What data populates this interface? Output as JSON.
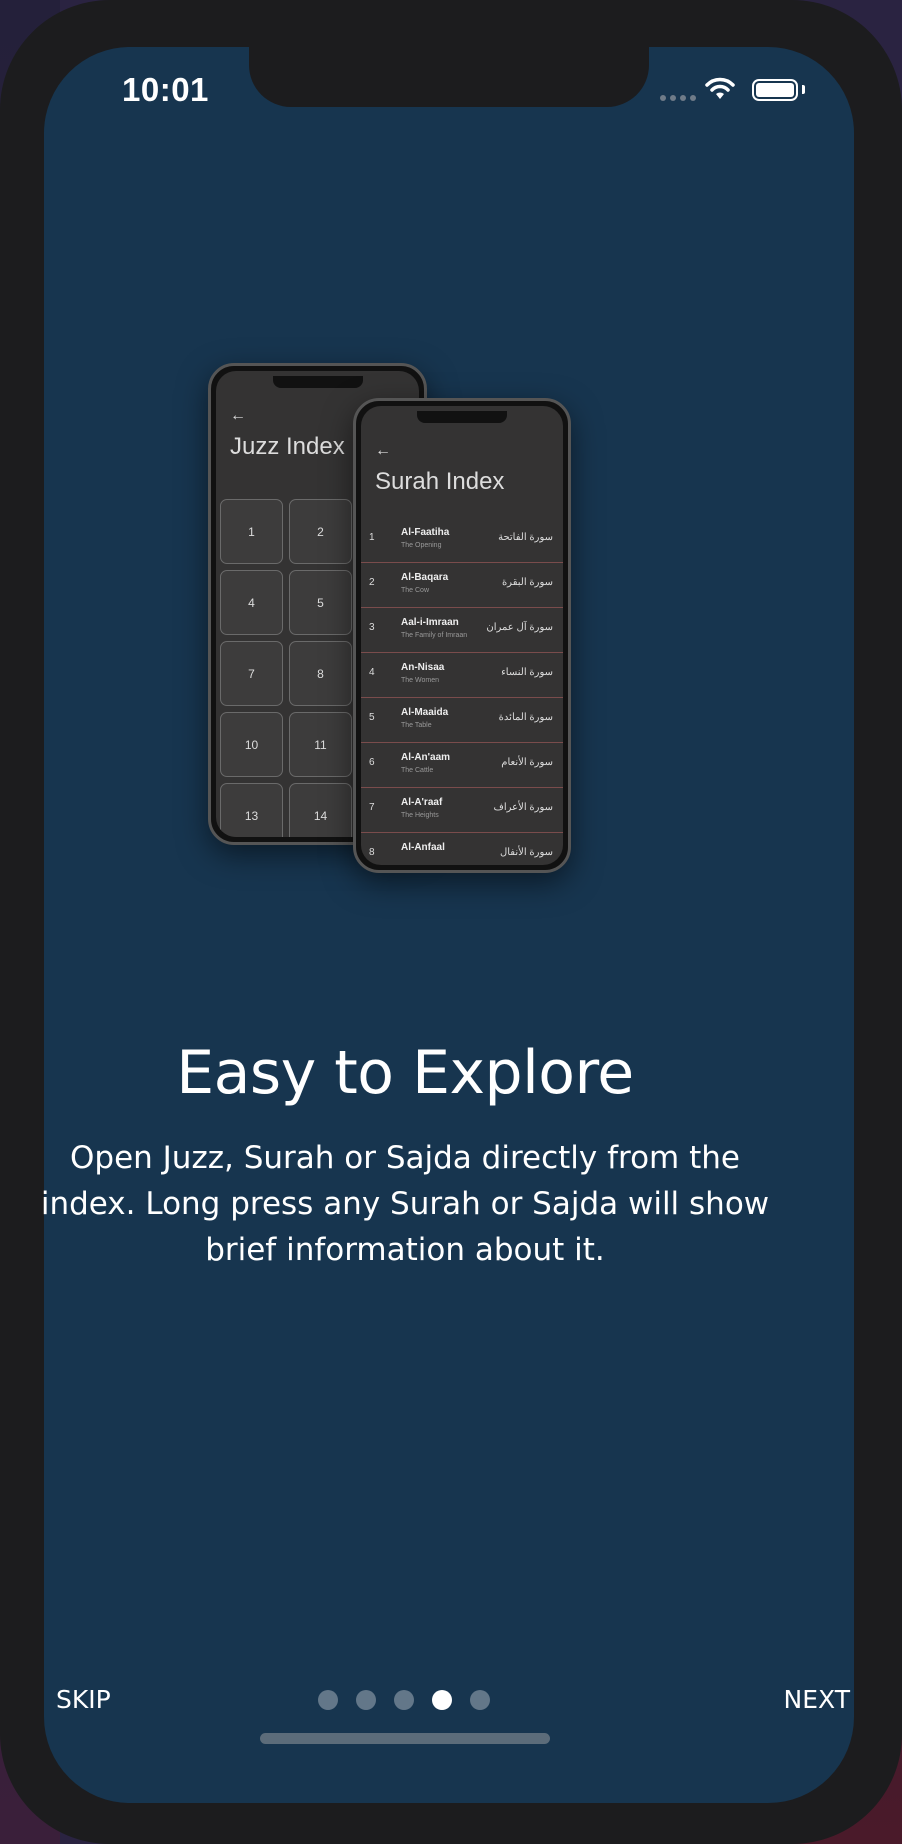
{
  "status_bar": {
    "time": "10:01"
  },
  "illustration": {
    "juzz": {
      "title": "Juzz Index",
      "cells": [
        "1",
        "2",
        "",
        "4",
        "5",
        "",
        "7",
        "8",
        "",
        "10",
        "11",
        "",
        "13",
        "14",
        ""
      ]
    },
    "surah": {
      "title": "Surah Index",
      "rows": [
        {
          "num": "1",
          "name": "Al-Faatiha",
          "meaning": "The Opening",
          "arabic": "سورة الفاتحة"
        },
        {
          "num": "2",
          "name": "Al-Baqara",
          "meaning": "The Cow",
          "arabic": "سورة البقرة"
        },
        {
          "num": "3",
          "name": "Aal-i-Imraan",
          "meaning": "The Family of Imraan",
          "arabic": "سورة آل عمران"
        },
        {
          "num": "4",
          "name": "An-Nisaa",
          "meaning": "The Women",
          "arabic": "سورة النساء"
        },
        {
          "num": "5",
          "name": "Al-Maaida",
          "meaning": "The Table",
          "arabic": "سورة المائدة"
        },
        {
          "num": "6",
          "name": "Al-An'aam",
          "meaning": "The Cattle",
          "arabic": "سورة الأنعام"
        },
        {
          "num": "7",
          "name": "Al-A'raaf",
          "meaning": "The Heights",
          "arabic": "سورة الأعراف"
        },
        {
          "num": "8",
          "name": "Al-Anfaal",
          "meaning": "",
          "arabic": "سورة الأنفال"
        }
      ]
    }
  },
  "onboarding": {
    "title": "Easy to Explore",
    "description": "Open Juzz, Surah or Sajda directly from the index. Long press any Surah or Sajda will show brief information about it.",
    "skip_label": "SKIP",
    "next_label": "NEXT",
    "page_count": 5,
    "active_page": 4
  },
  "colors": {
    "background": "#17354f",
    "dot_inactive": "#637789",
    "dot_active": "#ffffff"
  }
}
